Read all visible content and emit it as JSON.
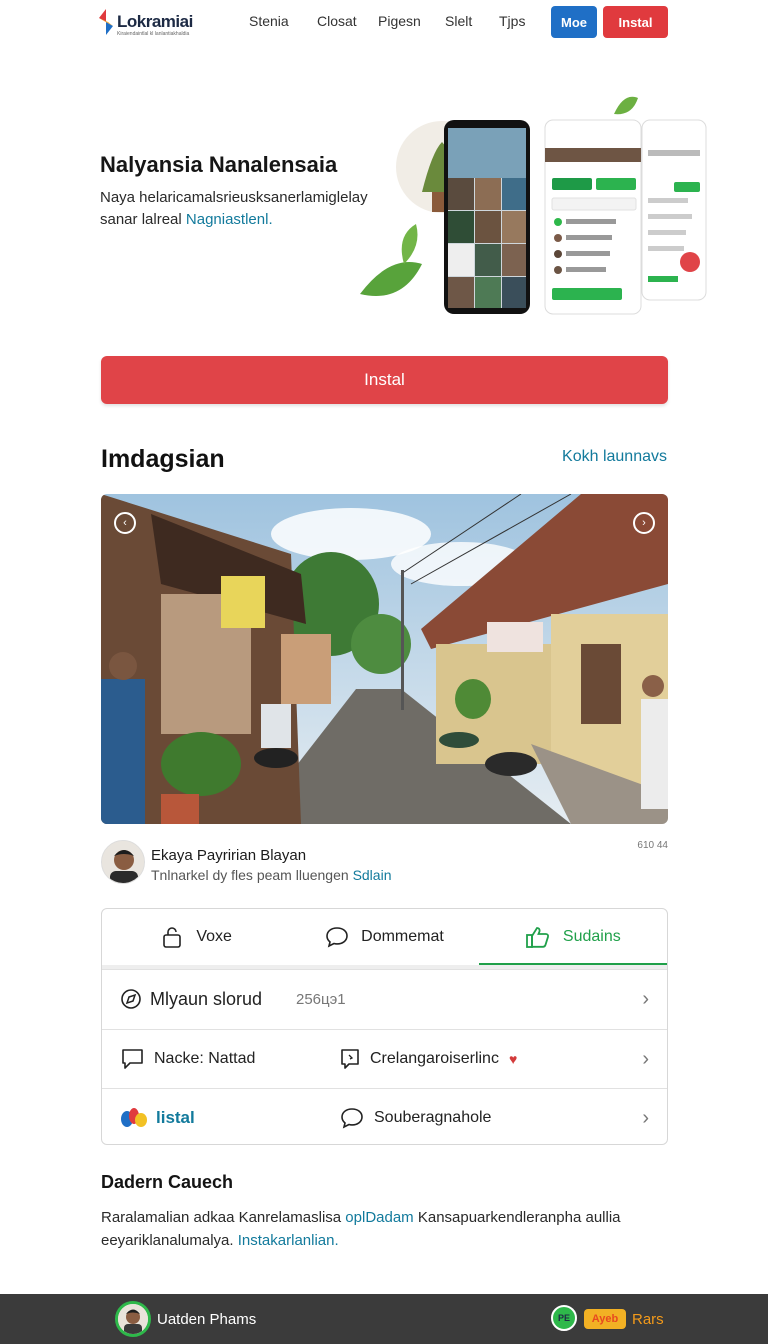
{
  "nav": {
    "logo_text": "Lokramiai",
    "logo_tagline": "Kiraiendaintlal kl lanlantiakhaldia",
    "links": [
      "Stenia",
      "Closat",
      "Pigesn",
      "Slelt",
      "Tjps"
    ],
    "mode_button": "Moe",
    "install_button": "Instal",
    "colors": {
      "mode": "#1f6fc6",
      "install": "#e03a3e"
    }
  },
  "hero": {
    "title": "Nalyansia Nanalensaia",
    "description": "Naya helaricamalsrieusksanerlamiglelay sanar lalreal",
    "description_link": "Nagniastlenl."
  },
  "cta": {
    "label": "Instal",
    "color": "#e04448"
  },
  "section": {
    "title": "Imdagsian",
    "link": "Kokh launnavs"
  },
  "photo": {
    "prev_icon": "chevron-left-circle-icon",
    "next_icon": "chevron-right-circle-icon"
  },
  "author": {
    "name": "Ekaya Payririan Blayan",
    "subtitle": "Tnlnarkel dy fles peam lluengen",
    "subtitle_link": "Sdlain",
    "meta": "610 44"
  },
  "tabs": [
    {
      "label": "Voxe",
      "icon": "lock-icon",
      "active": false
    },
    {
      "label": "Dommemat",
      "icon": "comment-icon",
      "active": false
    },
    {
      "label": "Sudains",
      "icon": "thumbs-up-icon",
      "active": true
    }
  ],
  "rows": [
    {
      "label": "Mlyaun slorud",
      "icon": "compass-icon",
      "value": "256цэ1"
    },
    {
      "label": "Nacke: Nattad",
      "icon": "chat-icon",
      "right_label": "Crelangaroiserlinc",
      "right_icon": "note-icon"
    },
    {
      "label": "listal",
      "icon": "brand-icon",
      "right_label": "Souberagnahole",
      "right_icon": "comment-icon"
    }
  ],
  "details": {
    "title": "Dadern Cauech",
    "text_1": "Raralamalian adkaa Kanrelamaslisa",
    "link_1": "oplDadam",
    "text_2": "Kansapuarkendleranpha aullia eeyariklanalumalya.",
    "link_2": "Instakarlanlian."
  },
  "bottom_bar": {
    "user_name": "Uatden Phams",
    "badge": "PE",
    "chip": "Ayeb",
    "label": "Rars"
  }
}
